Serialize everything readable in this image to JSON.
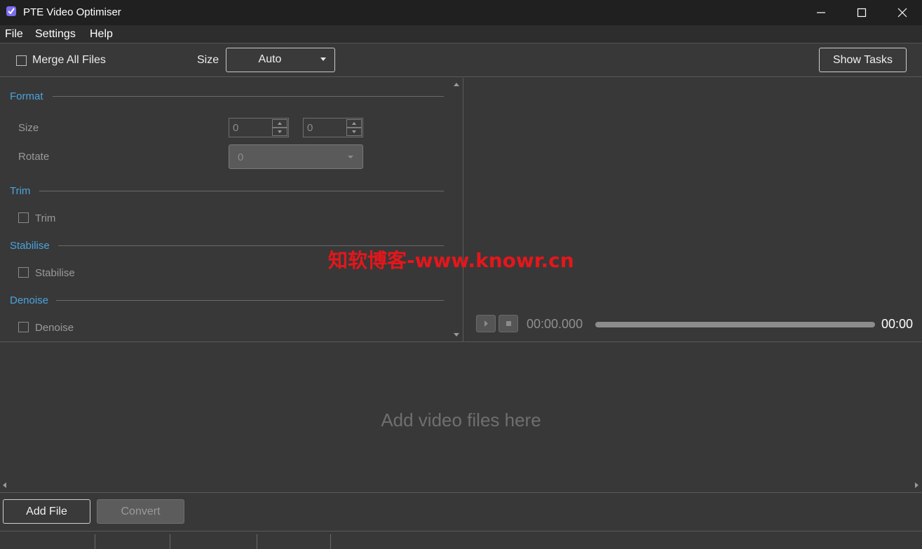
{
  "window": {
    "title": "PTE Video Optimiser"
  },
  "menu": {
    "items": [
      "File",
      "Settings",
      "Help"
    ]
  },
  "toolbar": {
    "merge_label": "Merge All Files",
    "size_label": "Size",
    "size_value": "Auto",
    "show_tasks": "Show Tasks"
  },
  "settings": {
    "format": {
      "title": "Format",
      "size_label": "Size",
      "width": "0",
      "height": "0",
      "rotate_label": "Rotate",
      "rotate_value": "0"
    },
    "trim": {
      "title": "Trim",
      "checkbox_label": "Trim"
    },
    "stabilise": {
      "title": "Stabilise",
      "checkbox_label": "Stabilise"
    },
    "denoise": {
      "title": "Denoise",
      "checkbox_label": "Denoise"
    }
  },
  "preview": {
    "current_time": "00:00.000",
    "duration": "00:00"
  },
  "file_list": {
    "placeholder": "Add video files here"
  },
  "actions": {
    "add_file": "Add File",
    "convert": "Convert"
  },
  "watermark": "知软博客-www.knowr.cn",
  "colors": {
    "accent": "#4aa3df",
    "background": "#383838",
    "titlebar": "#202020",
    "watermark": "#e5161b"
  }
}
